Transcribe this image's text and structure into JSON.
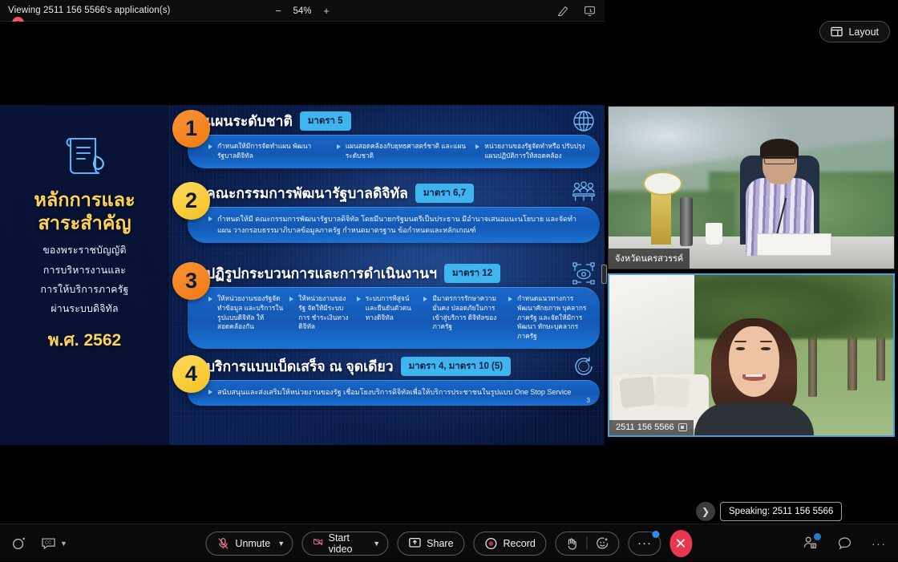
{
  "topbar": {
    "viewing_label": "Viewing 2511 156 5566's application(s)",
    "zoom_out": "−",
    "zoom_value": "54%",
    "zoom_in": "+",
    "annotate_icon": "annotate-icon",
    "remote_control_icon": "remote-screen-icon"
  },
  "layout_button": {
    "label": "Layout",
    "icon": "layout-panel-icon"
  },
  "recording_indicator": {
    "name": "recording-indicator"
  },
  "slide": {
    "left_panel": {
      "icon": "scroll-document-icon",
      "title_line1": "หลักการและ",
      "title_line2": "สาระสำคัญ",
      "sub_lines": [
        "ของพระราชบัญญัติ",
        "การบริหารงานและ",
        "การให้บริการภาครัฐ",
        "ผ่านระบบดิจิทัล"
      ],
      "year": "พ.ศ. 2562"
    },
    "page_number": "3",
    "items": [
      {
        "number": "1",
        "title": "แผนระดับชาติ",
        "badge": "มาตรา 5",
        "icon": "globe-icon",
        "bullets": [
          "กำหนดให้มีการจัดทำแผน พัฒนารัฐบาลดิจิทัล",
          "แผนสอดคล้องกับยุทธศาสตร์ชาติ และแผนระดับชาติ",
          "หน่วยงานของรัฐจัดทำหรือ ปรับปรุงแผนปฏิบัติการให้สอดคล้อง"
        ]
      },
      {
        "number": "2",
        "title": "คณะกรรมการพัฒนารัฐบาลดิจิทัล",
        "badge": "มาตรา 6,7",
        "icon": "committee-people-icon",
        "bullets": [
          "กำหนดให้มี คณะกรรมการพัฒนารัฐบาลดิจิทัล โดยมีนายกรัฐมนตรีเป็นประธาน มีอำนาจเสนอแนะนโยบาย และจัดทำแผน วางกรอบธรรมาภิบาลข้อมูลภาครัฐ กำหนดมาตรฐาน ข้อกำหนดและหลักเกณฑ์"
        ]
      },
      {
        "number": "3",
        "title": "ปฏิรูปกระบวนการและการดำเนินงานฯ",
        "badge": "มาตรา 12",
        "icon": "digital-network-icon",
        "bullets": [
          "ให้หน่วยงานของรัฐจัดทำข้อมูล และบริการในรูปแบบดิจิทัล ให้สอดคล้องกัน",
          "ให้หน่วยงานของรัฐ จัดให้มีระบบการ ชำระเงินทางดิจิทัล",
          "ระบบการพิสูจน์ และยืนยันตัวตน ทางดิจิทัล",
          "มีมาตรการรักษาความมั่นคง ปลอดภัยในการเข้าสู่บริการ ดิจิทัลของภาครัฐ",
          "กำหนดแนวทางการพัฒนาศักยภาพ บุคลากรภาครัฐ และจัดให้มีการพัฒนา ทักษะบุคลากรภาครัฐ"
        ]
      },
      {
        "number": "4",
        "title": "บริการแบบเบ็ดเสร็จ ณ จุดเดียว",
        "badge": "มาตรา 4, มาตรา 10 (5)",
        "icon": "one-stop-service-icon",
        "bullets": [
          "สนับสนุนและส่งเสริมให้หน่วยงานของรัฐ เชื่อมโยงบริการดิจิทัลเพื่อให้บริการประชาชนในรูปแบบ One Stop Service"
        ]
      }
    ]
  },
  "thumbnails": [
    {
      "name": "จังหวัดนครสวรรค์",
      "active": false,
      "sharing": false
    },
    {
      "name": "2511 156 5566",
      "active": true,
      "sharing": true
    }
  ],
  "speaking": {
    "prev_icon": "chevron-right-icon",
    "label": "Speaking: 2511 156 5566"
  },
  "bottombar": {
    "left": [
      {
        "name": "audio-settings-icon",
        "label": ""
      },
      {
        "name": "closed-caption-icon",
        "label": ""
      }
    ],
    "unmute": {
      "label": "Unmute",
      "icon": "microphone-muted-icon"
    },
    "start_video": {
      "label": "Start video",
      "icon": "camera-off-icon"
    },
    "share": {
      "label": "Share",
      "icon": "share-screen-icon"
    },
    "record": {
      "label": "Record",
      "icon": "record-circle-icon"
    },
    "raise_hand": {
      "icon": "raise-hand-icon"
    },
    "reactions": {
      "icon": "emoji-reaction-icon"
    },
    "more": {
      "label": "···",
      "has_badge": true
    },
    "leave": {
      "icon": "close-x-icon"
    },
    "participants": {
      "icon": "participants-icon",
      "has_badge": true
    },
    "chat": {
      "icon": "chat-bubble-icon"
    },
    "more_right": {
      "label": "···"
    }
  },
  "colors": {
    "accent_blue": "#2f8ded",
    "leave_red": "#e8384f",
    "badge_blue": "#3fb4ef",
    "slide_yellow": "#ffd358",
    "active_border": "#4a9fe0"
  }
}
